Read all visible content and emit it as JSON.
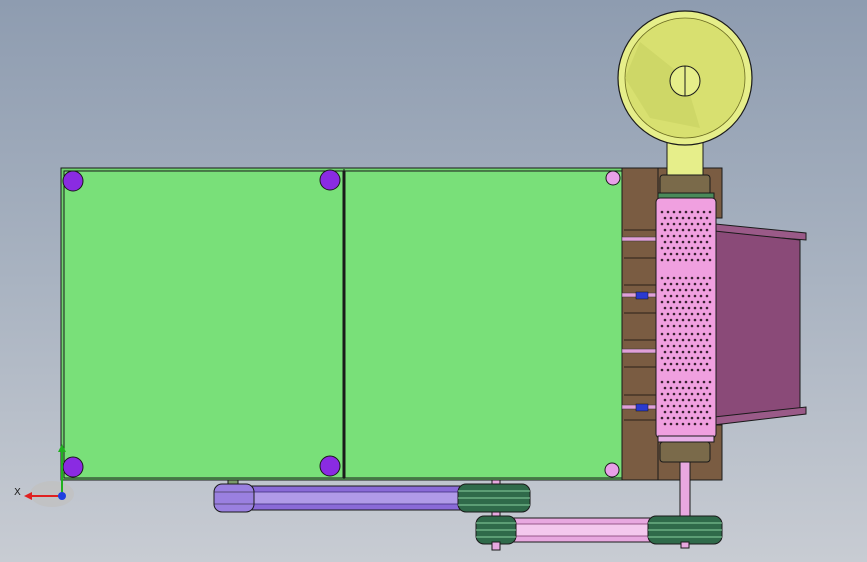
{
  "view": {
    "background_top": "#8e9cb0",
    "background_bottom": "#c8ccd3"
  },
  "triad": {
    "x_label": "X",
    "x_color": "#e02020",
    "y_color": "#20b020",
    "z_color": "#2040e0"
  },
  "colors": {
    "panel_green": "#79e079",
    "bolt_purple": "#8a2be2",
    "bolt_pink": "#e8a0e8",
    "frame_brown": "#7a5c42",
    "drum_pink": "#f0a0e0",
    "chute_purple": "#8a4a78",
    "hopper_yellow": "#e6ee8a",
    "belt_violet": "#9a70e0",
    "pulley_green": "#2f6a4a"
  }
}
